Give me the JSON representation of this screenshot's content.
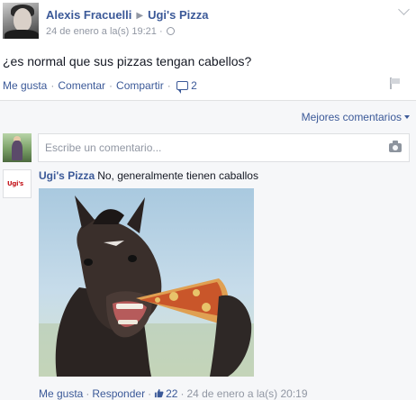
{
  "post": {
    "author": "Alexis Fracuelli",
    "target_page": "Ugi's Pizza",
    "timestamp": "24 de enero a la(s) 19:21",
    "separator": "·",
    "text": "¿es normal que sus pizzas tengan cabellos?",
    "actions": {
      "like": "Me gusta",
      "comment": "Comentar",
      "share": "Compartir",
      "comment_count": "2"
    }
  },
  "comments_section": {
    "sort_label": "Mejores comentarios",
    "input_placeholder": "Escribe un comentario..."
  },
  "comment": {
    "author": "Ugi's Pizza",
    "text": "No, generalmente tienen caballos",
    "avatar_logo": "Ugi's",
    "actions": {
      "like": "Me gusta",
      "reply": "Responder",
      "like_count": "22",
      "timestamp": "24 de enero a la(s) 20:19"
    }
  },
  "colors": {
    "link_blue": "#3b5998",
    "meta_gray": "#9197a3",
    "comments_bg": "#f6f7f9"
  }
}
